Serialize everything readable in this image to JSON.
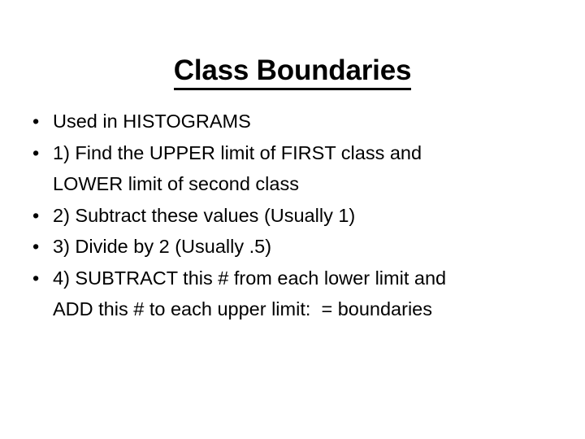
{
  "slide": {
    "title": "Class Boundaries",
    "bullet_char": "•",
    "background_color": "#ffffff",
    "text_color": "#000000",
    "bullets": [
      {
        "lines": [
          "Used in HISTOGRAMS"
        ]
      },
      {
        "lines": [
          "1) Find the UPPER limit of FIRST class and",
          "LOWER limit of second class"
        ]
      },
      {
        "lines": [
          "2) Subtract these values (Usually 1)"
        ]
      },
      {
        "lines": [
          "3) Divide by 2 (Usually .5)"
        ]
      },
      {
        "lines": [
          "4) SUBTRACT this # from each lower limit and",
          "ADD this # to each upper limit:  = boundaries"
        ]
      }
    ]
  }
}
